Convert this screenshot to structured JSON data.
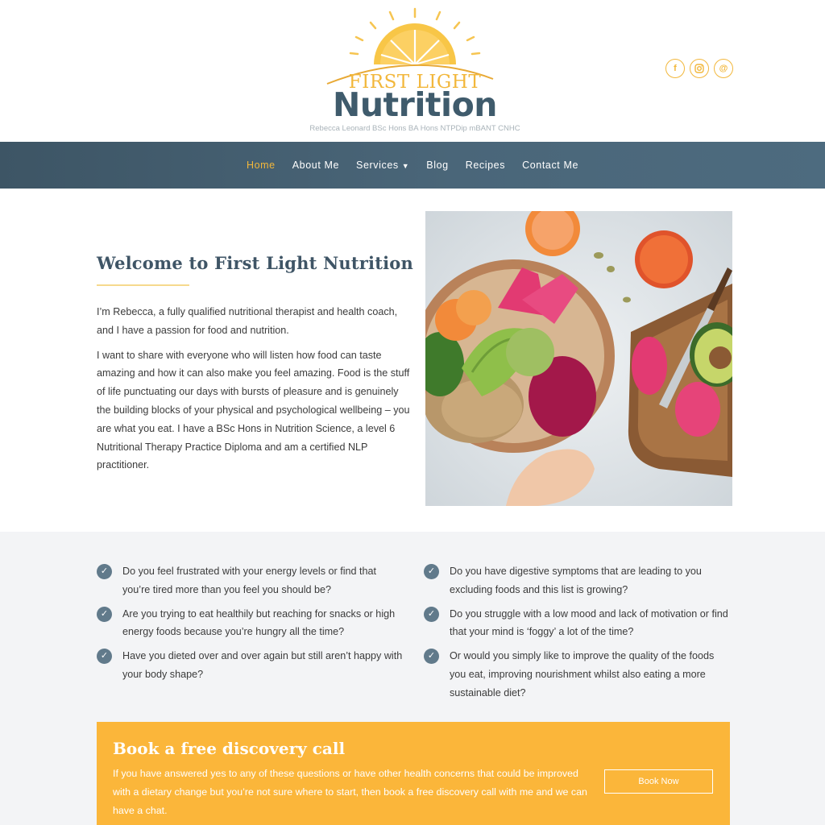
{
  "brand": {
    "logo_top": "FIRST LIGHT",
    "logo_main": "Nutrition",
    "logo_sub": "Rebecca Leonard BSc Hons BA Hons NTPDip mBANT CNHC",
    "colors": {
      "gold": "#f2b73b",
      "slate": "#3f5b6c",
      "nav": "#466073",
      "cta": "#fbb63a"
    }
  },
  "social": [
    {
      "icon": "facebook-icon",
      "glyph": "f"
    },
    {
      "icon": "instagram-icon",
      "glyph": "◎"
    },
    {
      "icon": "email-icon",
      "glyph": "@"
    }
  ],
  "nav": {
    "items": [
      "Home",
      "About Me",
      "Services",
      "Blog",
      "Recipes",
      "Contact Me"
    ],
    "active": "Home"
  },
  "intro": {
    "title": "Welcome to First Light Nutrition",
    "p1": "I’m Rebecca, a fully qualified nutritional therapist and health coach, and I have a passion for food and nutrition.",
    "p2": "I want to share with everyone who will listen how food can taste amazing and how it can also make you feel amazing. Food is the stuff of life punctuating our days with bursts of pleasure and is genuinely the building blocks of your physical and psychological wellbeing – you are what you eat. I have a BSc Hons in Nutrition Science, a level 6 Nutritional Therapy Practice Diploma and am a certified NLP practitioner."
  },
  "questions": {
    "left": [
      "Do you feel frustrated with your energy levels or find that you’re tired more than you feel you should be?",
      "Are you trying to eat healthily but reaching for snacks or high energy foods because you’re hungry all the time?",
      "Have you dieted over and over again but still aren’t happy with your body shape?"
    ],
    "right": [
      "Do you have digestive symptoms that are leading to you excluding foods and this list is growing?",
      "Do you struggle with a low mood and lack of motivation or find that your mind is ‘foggy’ a lot of the time?",
      "Or would you simply like to improve the quality of the foods you eat, improving nourishment whilst also eating a more sustainable diet?"
    ]
  },
  "cta": {
    "title": "Book a free discovery call",
    "text": "If you have answered yes to any of these questions or have other health concerns that could be improved with a dietary change but you’re not sure where to start, then book a free discovery call with me and we can have a chat.",
    "button": "Book Now"
  }
}
